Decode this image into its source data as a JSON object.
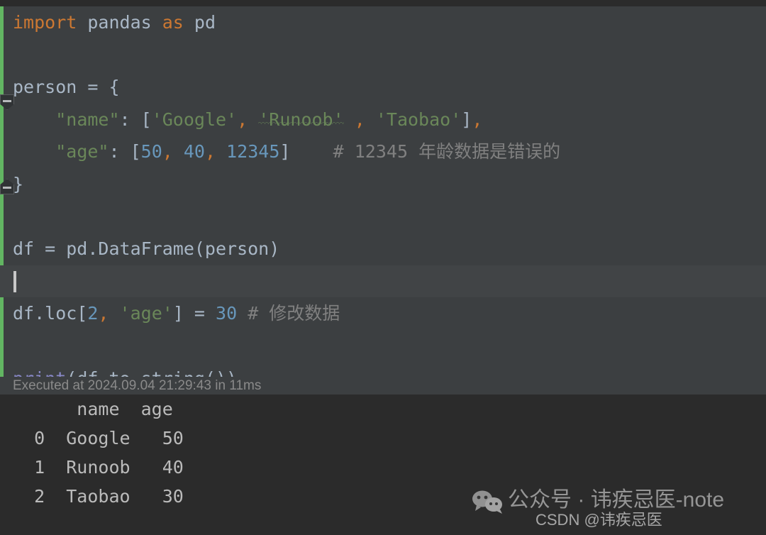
{
  "editor": {
    "language": "python",
    "background_color": "#3c3f41",
    "run_gutter_color": "#62b562",
    "fold_markers": [
      {
        "name": "fold-open-person",
        "state": "expanded",
        "line": 3
      },
      {
        "name": "fold-close-person",
        "state": "end",
        "line": 6
      }
    ],
    "lines": [
      {
        "n": 1,
        "tokens": [
          {
            "t": "import",
            "c": "kw"
          },
          {
            "t": " pandas ",
            "c": "ident"
          },
          {
            "t": "as",
            "c": "kw"
          },
          {
            "t": " pd",
            "c": "ident"
          }
        ]
      },
      {
        "n": 2,
        "tokens": []
      },
      {
        "n": 3,
        "tokens": [
          {
            "t": "person = {",
            "c": "ident"
          }
        ]
      },
      {
        "n": 4,
        "tokens": [
          {
            "t": "    ",
            "c": "ident"
          },
          {
            "t": "\"name\"",
            "c": "str"
          },
          {
            "t": ": [",
            "c": "punc"
          },
          {
            "t": "'Google'",
            "c": "str"
          },
          {
            "t": ",",
            "c": "comma"
          },
          {
            "t": " ",
            "c": "ident"
          },
          {
            "t": "'Runoob'",
            "c": "str",
            "squiggle": true
          },
          {
            "t": " ",
            "c": "ident"
          },
          {
            "t": ",",
            "c": "comma"
          },
          {
            "t": " ",
            "c": "ident"
          },
          {
            "t": "'Taobao'",
            "c": "str"
          },
          {
            "t": "]",
            "c": "punc"
          },
          {
            "t": ",",
            "c": "comma"
          }
        ]
      },
      {
        "n": 5,
        "tokens": [
          {
            "t": "    ",
            "c": "ident"
          },
          {
            "t": "\"age\"",
            "c": "str"
          },
          {
            "t": ": [",
            "c": "punc"
          },
          {
            "t": "50",
            "c": "num"
          },
          {
            "t": ",",
            "c": "comma"
          },
          {
            "t": " ",
            "c": "ident"
          },
          {
            "t": "40",
            "c": "num"
          },
          {
            "t": ",",
            "c": "comma"
          },
          {
            "t": " ",
            "c": "ident"
          },
          {
            "t": "12345",
            "c": "num"
          },
          {
            "t": "]",
            "c": "punc"
          },
          {
            "t": "    ",
            "c": "ident"
          },
          {
            "t": "# 12345 年龄数据是错误的",
            "c": "com"
          }
        ]
      },
      {
        "n": 6,
        "tokens": [
          {
            "t": "}",
            "c": "ident"
          }
        ]
      },
      {
        "n": 7,
        "tokens": []
      },
      {
        "n": 8,
        "tokens": [
          {
            "t": "df = pd.DataFrame(person)",
            "c": "ident"
          }
        ]
      },
      {
        "n": 9,
        "tokens": [],
        "caret": true
      },
      {
        "n": 10,
        "tokens": [
          {
            "t": "df.loc[",
            "c": "ident"
          },
          {
            "t": "2",
            "c": "num"
          },
          {
            "t": ",",
            "c": "comma"
          },
          {
            "t": " ",
            "c": "ident"
          },
          {
            "t": "'age'",
            "c": "str"
          },
          {
            "t": "] = ",
            "c": "punc"
          },
          {
            "t": "30",
            "c": "num"
          },
          {
            "t": " ",
            "c": "ident"
          },
          {
            "t": "# 修改数据",
            "c": "com"
          }
        ]
      },
      {
        "n": 11,
        "tokens": []
      },
      {
        "n": 12,
        "tokens": [
          {
            "t": "print",
            "c": "fn"
          },
          {
            "t": "(df.to_string())",
            "c": "ident"
          }
        ]
      }
    ],
    "execution_status": "Executed at 2024.09.04 21:29:43 in 11ms"
  },
  "output": {
    "background_color": "#2b2b2b",
    "lines": [
      "      name  age",
      "  0  Google   50",
      "  1  Runoob   40",
      "  2  Taobao   30"
    ],
    "table": {
      "columns": [
        "",
        "name",
        "age"
      ],
      "rows": [
        [
          "0",
          "Google",
          "50"
        ],
        [
          "1",
          "Runoob",
          "40"
        ],
        [
          "2",
          "Taobao",
          "30"
        ]
      ]
    }
  },
  "watermark": {
    "icon": "wechat-icon",
    "main_text": "公众号 · 讳疾忌医-note",
    "sub_text": "CSDN @讳疾忌医"
  },
  "colors": {
    "keyword": "#cc7832",
    "string": "#6a8759",
    "number": "#6897bb",
    "comment": "#808080",
    "function": "#8888c6",
    "default_text": "#a9b7c6",
    "editor_bg": "#3c3f41",
    "output_bg": "#2b2b2b",
    "run_bar": "#62b562"
  }
}
